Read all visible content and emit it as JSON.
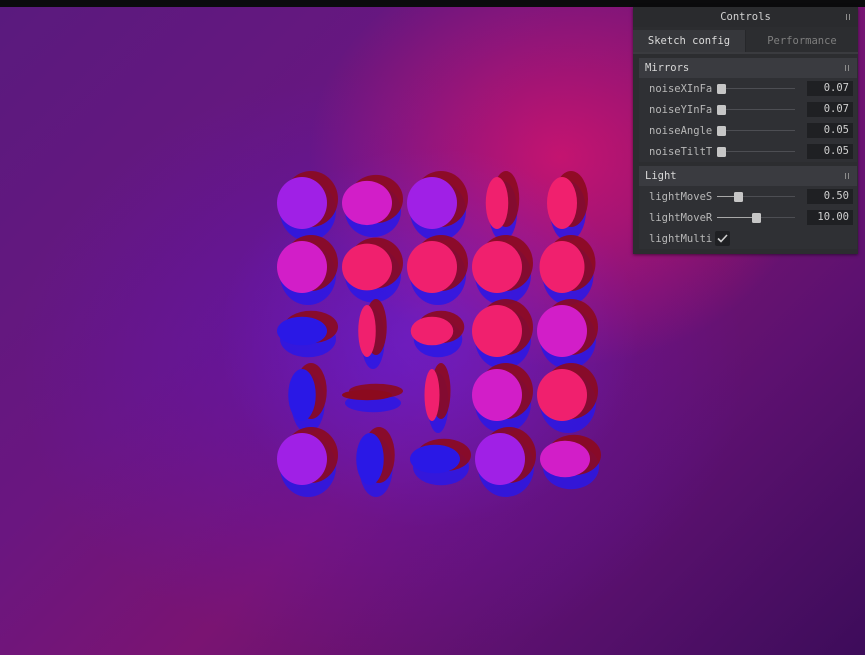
{
  "panel": {
    "title": "Controls",
    "tabs": [
      {
        "label": "Sketch config",
        "active": true
      },
      {
        "label": "Performance",
        "active": false
      }
    ],
    "folders": {
      "mirrors": {
        "title": "Mirrors",
        "controls": [
          {
            "label": "noiseXInFa",
            "value": "0.07",
            "fraction": 0.0
          },
          {
            "label": "noiseYInFa",
            "value": "0.07",
            "fraction": 0.0
          },
          {
            "label": "noiseAngle",
            "value": "0.05",
            "fraction": 0.0
          },
          {
            "label": "noiseTiltT",
            "value": "0.05",
            "fraction": 0.0
          }
        ]
      },
      "light": {
        "title": "Light",
        "controls": [
          {
            "label": "lightMoveS",
            "value": "0.50",
            "fraction": 0.25
          },
          {
            "label": "lightMoveR",
            "value": "10.00",
            "fraction": 0.5
          }
        ],
        "toggle": {
          "label": "lightMulti",
          "checked": true
        }
      }
    }
  },
  "colors": {
    "panel_bg": "#2c2d30",
    "folder_header": "#3a3b40",
    "value_bg": "#1f2023",
    "mirror_face_magenta": "#d21ec8",
    "mirror_face_pink": "#f0206e",
    "mirror_face_violet": "#a020e6",
    "mirror_back_red": "#8c0a1e",
    "mirror_shadow_blue": "#2a18e6"
  }
}
